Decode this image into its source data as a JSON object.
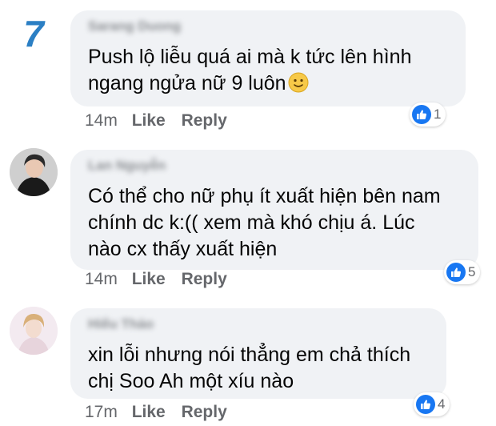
{
  "comments": [
    {
      "author": "Sarang Duong",
      "lines": [
        "Push lộ liễu quá ai mà k tức lên hình",
        "ngang ngửa nữ 9 luôn"
      ],
      "emoji": "slightly-smiling-face-icon",
      "age": "14m",
      "like_label": "Like",
      "reply_label": "Reply",
      "reactions": "1"
    },
    {
      "author": "Lan Nguyễn",
      "lines": [
        "Có thể cho nữ phụ ít xuất hiện bên nam",
        "chính dc k:(( xem mà khó chịu á. Lúc",
        "nào cx thấy xuất hiện"
      ],
      "age": "14m",
      "like_label": "Like",
      "reply_label": "Reply",
      "reactions": "5"
    },
    {
      "author": "Hiếu Thảo",
      "lines": [
        "xin lỗi nhưng nói thẳng em chả thích",
        "chị Soo Ah một xíu nào"
      ],
      "age": "17m",
      "like_label": "Like",
      "reply_label": "Reply",
      "reactions": "4"
    }
  ],
  "colors": {
    "bubble": "#f0f2f5",
    "like_blue": "#1877f2",
    "meta_gray": "#65676b"
  }
}
